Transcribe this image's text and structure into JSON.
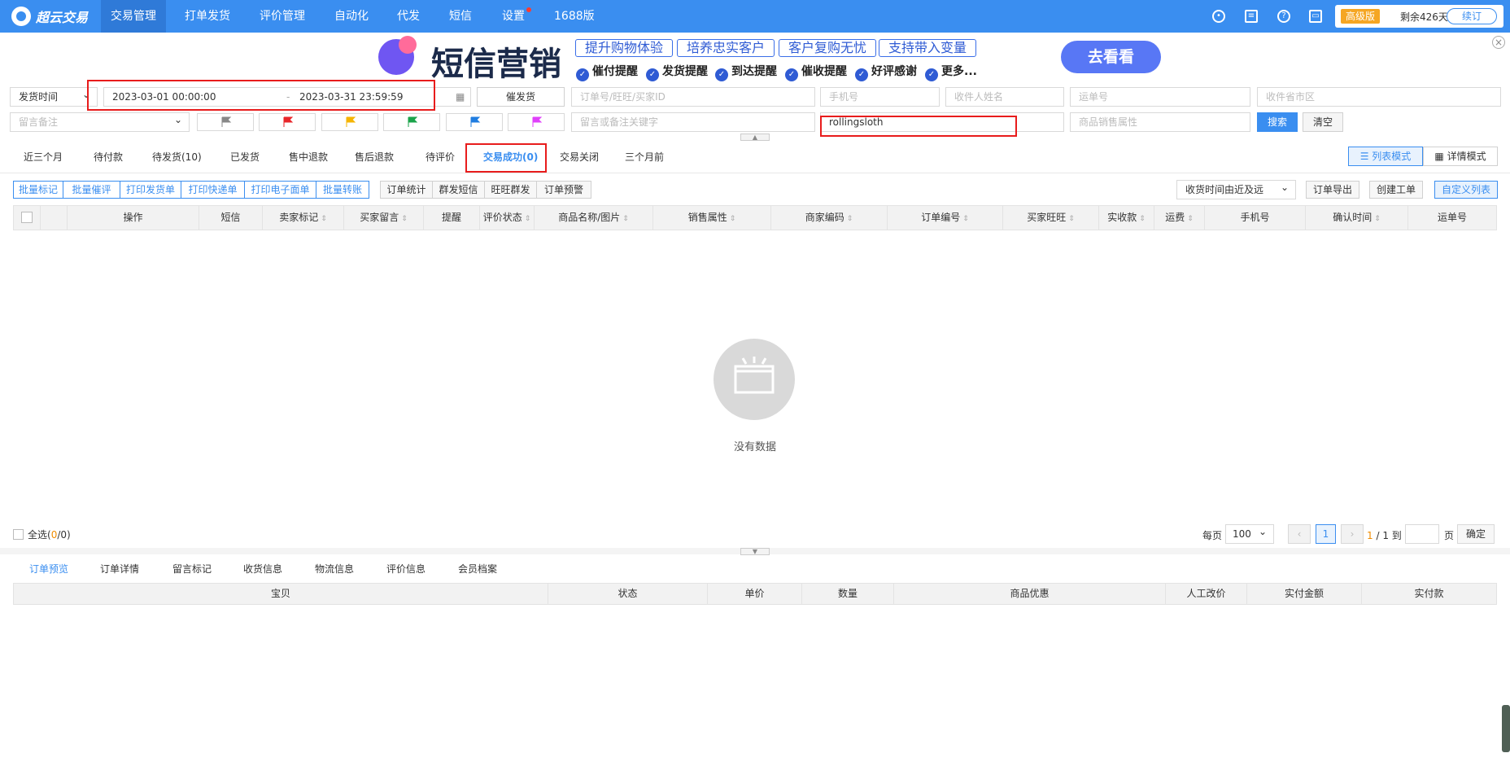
{
  "brand": {
    "name": "超云交易"
  },
  "nav": {
    "items": [
      "交易管理",
      "打单发货",
      "评价管理",
      "自动化",
      "代发",
      "短信",
      "设置",
      "1688版"
    ]
  },
  "account": {
    "plan": "高级版",
    "days_left": "剩余426天",
    "renew": "续订"
  },
  "banner": {
    "title": "短信营销",
    "pills": [
      "提升购物体验",
      "培养忠实客户",
      "客户复购无忧",
      "支持带入变量"
    ],
    "checks": [
      "催付提醒",
      "发货提醒",
      "到达提醒",
      "催收提醒",
      "好评感谢",
      "更多..."
    ],
    "cta": "去看看"
  },
  "filters": {
    "time_type": "发货时间",
    "date_start": "2023-03-01 00:00:00",
    "date_sep": "-",
    "date_end": "2023-03-31 23:59:59",
    "remind_btn": "催发货",
    "order_placeholder": "订单号/旺旺/买家ID",
    "phone_placeholder": "手机号",
    "receiver_placeholder": "收件人姓名",
    "waybill_placeholder": "运单号",
    "region_placeholder": "收件省市区",
    "remark_select": "留言备注",
    "remark_keyword_placeholder": "留言或备注关键字",
    "product_keyword": "rollingsloth",
    "sale_attr_placeholder": "商品销售属性",
    "search": "搜索",
    "clear": "清空"
  },
  "status_tabs": [
    "近三个月",
    "待付款",
    "待发货(10)",
    "已发货",
    "售中退款",
    "售后退款",
    "待评价",
    "交易成功(0)",
    "交易关闭",
    "三个月前"
  ],
  "view_modes": {
    "list": "列表模式",
    "detail": "详情模式"
  },
  "batch_actions": [
    "批量标记",
    "批量催评",
    "打印发货单",
    "打印快递单",
    "打印电子面单",
    "批量转账"
  ],
  "tools": [
    "订单统计",
    "群发短信",
    "旺旺群发",
    "订单预警"
  ],
  "sort_select": "收货时间由近及远",
  "right_actions": [
    "订单导出",
    "创建工单",
    "自定义列表"
  ],
  "columns": [
    "操作",
    "短信",
    "卖家标记",
    "买家留言",
    "提醒",
    "评价状态",
    "商品名称/图片",
    "销售属性",
    "商家编码",
    "订单编号",
    "买家旺旺",
    "实收款",
    "运费",
    "手机号",
    "确认时间",
    "运单号"
  ],
  "empty": "没有数据",
  "footer": {
    "select_all": "全选(",
    "selected": "0",
    "slash": "/",
    "total": "0",
    "close_paren": ")",
    "per_page_label": "每页",
    "per_page": "100",
    "page": "1",
    "page_info_cur": "1",
    "page_info_rest": "/ 1 到",
    "page_unit": "页",
    "confirm": "确定"
  },
  "detail_tabs": [
    "订单预览",
    "订单详情",
    "留言标记",
    "收货信息",
    "物流信息",
    "评价信息",
    "会员档案"
  ],
  "detail_columns": [
    "宝贝",
    "状态",
    "单价",
    "数量",
    "商品优惠",
    "人工改价",
    "实付金额",
    "实付款"
  ],
  "colors": {
    "brand": "#3a8ef0",
    "highlight": "#e81c1c"
  }
}
